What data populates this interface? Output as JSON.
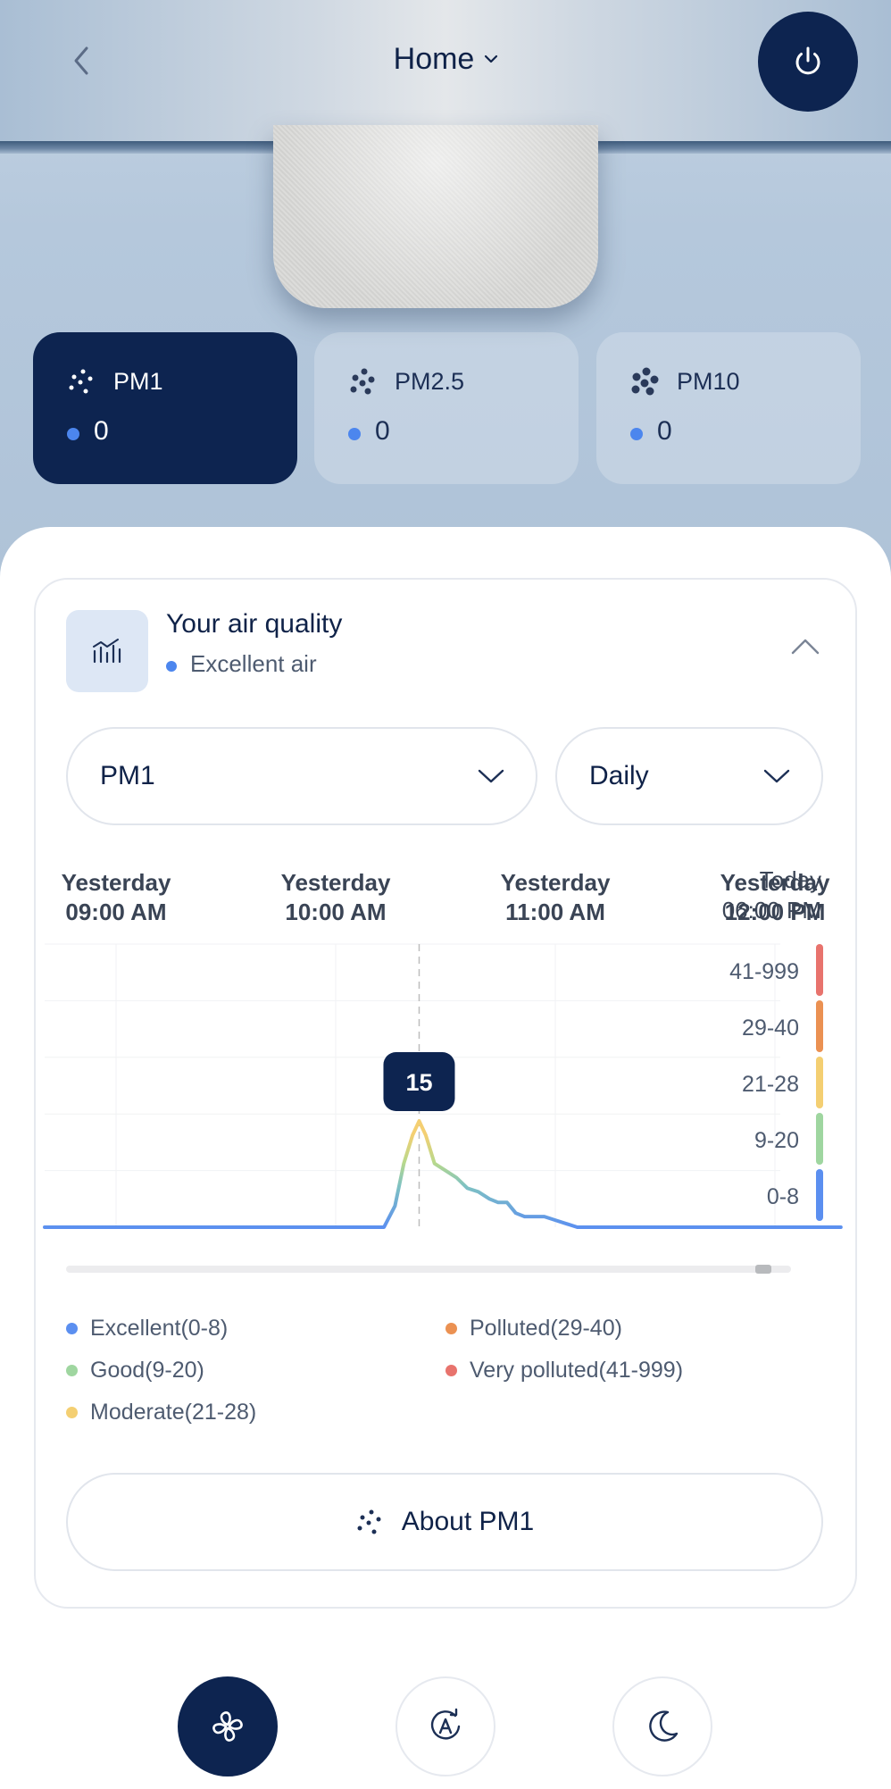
{
  "header": {
    "title": "Home",
    "back_icon": "chevron-left-icon",
    "title_dropdown_icon": "chevron-down-icon",
    "power_icon": "power-icon"
  },
  "pm_tiles": [
    {
      "label": "PM1",
      "value": "0",
      "selected": true
    },
    {
      "label": "PM2.5",
      "value": "0",
      "selected": false
    },
    {
      "label": "PM10",
      "value": "0",
      "selected": false
    }
  ],
  "air_quality": {
    "title": "Your air quality",
    "status": "Excellent air",
    "status_color": "#4c86ee"
  },
  "filters": {
    "pollutant": "PM1",
    "period": "Daily"
  },
  "chart_data": {
    "type": "line",
    "x_ticks": [
      {
        "line1": "Yesterday",
        "line2": "09:00 AM"
      },
      {
        "line1": "Yesterday",
        "line2": "10:00 AM"
      },
      {
        "line1": "Yesterday",
        "line2": "11:00 AM"
      },
      {
        "line1": "Yesterday",
        "line2": "12:00 PM"
      },
      {
        "line1": "Today",
        "line2": "06:00 PM"
      }
    ],
    "bands": [
      {
        "label": "41-999",
        "color": "#e8736d"
      },
      {
        "label": "29-40",
        "color": "#eb9152"
      },
      {
        "label": "21-28",
        "color": "#f4cf72"
      },
      {
        "label": "9-20",
        "color": "#9fd6a0"
      },
      {
        "label": "0-8",
        "color": "#5b8ff0"
      }
    ],
    "ylim": [
      0,
      40
    ],
    "series": [
      {
        "x": [
          0,
          0.3,
          0.6,
          0.95,
          1.22,
          1.27,
          1.31,
          1.35,
          1.38,
          1.41,
          1.45,
          1.5,
          1.55,
          1.6,
          1.65,
          1.7,
          1.74,
          1.78,
          1.82,
          1.86,
          1.9,
          1.95,
          2.0,
          2.1,
          2.2,
          2.5,
          3.0,
          3.3
        ],
        "y": [
          0,
          0,
          0,
          0,
          0,
          3,
          9,
          13,
          15,
          13,
          9,
          8,
          7,
          5.5,
          5,
          4,
          3.5,
          3.5,
          2,
          1.5,
          1.5,
          1.5,
          1,
          0,
          0,
          0,
          0,
          0
        ]
      }
    ],
    "selected": {
      "x": 1.38,
      "label": "15"
    }
  },
  "legend": [
    {
      "label": "Excellent(0-8)",
      "color": "#5b8ff0"
    },
    {
      "label": "Good(9-20)",
      "color": "#9fd6a0"
    },
    {
      "label": "Moderate(21-28)",
      "color": "#f4cf72"
    },
    {
      "label": "Polluted(29-40)",
      "color": "#eb9152"
    },
    {
      "label": "Very polluted(41-999)",
      "color": "#e8736d"
    }
  ],
  "about_button": {
    "label": "About PM1"
  },
  "modes": [
    {
      "icon": "fan-icon",
      "active": true
    },
    {
      "icon": "auto-mode-icon",
      "active": false
    },
    {
      "icon": "moon-icon",
      "active": false
    }
  ]
}
